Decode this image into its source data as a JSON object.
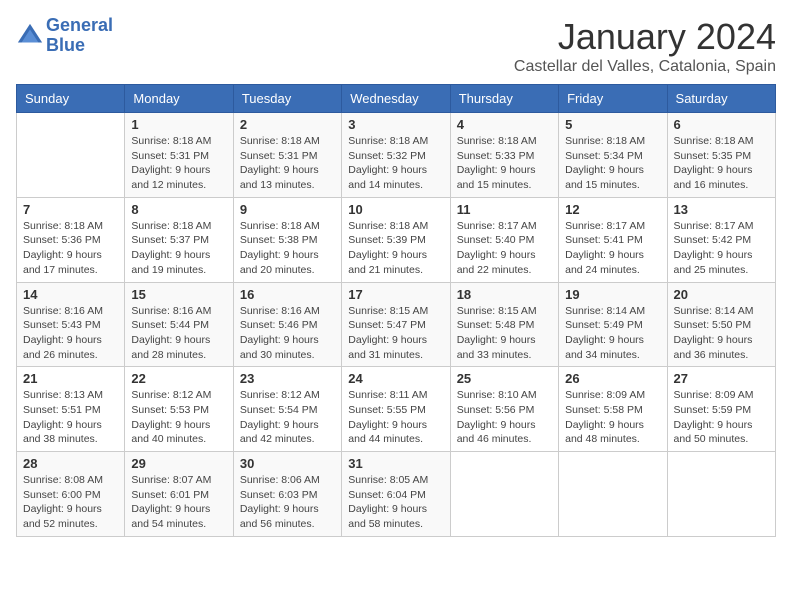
{
  "logo": {
    "line1": "General",
    "line2": "Blue"
  },
  "title": "January 2024",
  "location": "Castellar del Valles, Catalonia, Spain",
  "headers": [
    "Sunday",
    "Monday",
    "Tuesday",
    "Wednesday",
    "Thursday",
    "Friday",
    "Saturday"
  ],
  "weeks": [
    [
      {
        "day": "",
        "sunrise": "",
        "sunset": "",
        "daylight": ""
      },
      {
        "day": "1",
        "sunrise": "Sunrise: 8:18 AM",
        "sunset": "Sunset: 5:31 PM",
        "daylight": "Daylight: 9 hours and 12 minutes."
      },
      {
        "day": "2",
        "sunrise": "Sunrise: 8:18 AM",
        "sunset": "Sunset: 5:31 PM",
        "daylight": "Daylight: 9 hours and 13 minutes."
      },
      {
        "day": "3",
        "sunrise": "Sunrise: 8:18 AM",
        "sunset": "Sunset: 5:32 PM",
        "daylight": "Daylight: 9 hours and 14 minutes."
      },
      {
        "day": "4",
        "sunrise": "Sunrise: 8:18 AM",
        "sunset": "Sunset: 5:33 PM",
        "daylight": "Daylight: 9 hours and 15 minutes."
      },
      {
        "day": "5",
        "sunrise": "Sunrise: 8:18 AM",
        "sunset": "Sunset: 5:34 PM",
        "daylight": "Daylight: 9 hours and 15 minutes."
      },
      {
        "day": "6",
        "sunrise": "Sunrise: 8:18 AM",
        "sunset": "Sunset: 5:35 PM",
        "daylight": "Daylight: 9 hours and 16 minutes."
      }
    ],
    [
      {
        "day": "7",
        "sunrise": "Sunrise: 8:18 AM",
        "sunset": "Sunset: 5:36 PM",
        "daylight": "Daylight: 9 hours and 17 minutes."
      },
      {
        "day": "8",
        "sunrise": "Sunrise: 8:18 AM",
        "sunset": "Sunset: 5:37 PM",
        "daylight": "Daylight: 9 hours and 19 minutes."
      },
      {
        "day": "9",
        "sunrise": "Sunrise: 8:18 AM",
        "sunset": "Sunset: 5:38 PM",
        "daylight": "Daylight: 9 hours and 20 minutes."
      },
      {
        "day": "10",
        "sunrise": "Sunrise: 8:18 AM",
        "sunset": "Sunset: 5:39 PM",
        "daylight": "Daylight: 9 hours and 21 minutes."
      },
      {
        "day": "11",
        "sunrise": "Sunrise: 8:17 AM",
        "sunset": "Sunset: 5:40 PM",
        "daylight": "Daylight: 9 hours and 22 minutes."
      },
      {
        "day": "12",
        "sunrise": "Sunrise: 8:17 AM",
        "sunset": "Sunset: 5:41 PM",
        "daylight": "Daylight: 9 hours and 24 minutes."
      },
      {
        "day": "13",
        "sunrise": "Sunrise: 8:17 AM",
        "sunset": "Sunset: 5:42 PM",
        "daylight": "Daylight: 9 hours and 25 minutes."
      }
    ],
    [
      {
        "day": "14",
        "sunrise": "Sunrise: 8:16 AM",
        "sunset": "Sunset: 5:43 PM",
        "daylight": "Daylight: 9 hours and 26 minutes."
      },
      {
        "day": "15",
        "sunrise": "Sunrise: 8:16 AM",
        "sunset": "Sunset: 5:44 PM",
        "daylight": "Daylight: 9 hours and 28 minutes."
      },
      {
        "day": "16",
        "sunrise": "Sunrise: 8:16 AM",
        "sunset": "Sunset: 5:46 PM",
        "daylight": "Daylight: 9 hours and 30 minutes."
      },
      {
        "day": "17",
        "sunrise": "Sunrise: 8:15 AM",
        "sunset": "Sunset: 5:47 PM",
        "daylight": "Daylight: 9 hours and 31 minutes."
      },
      {
        "day": "18",
        "sunrise": "Sunrise: 8:15 AM",
        "sunset": "Sunset: 5:48 PM",
        "daylight": "Daylight: 9 hours and 33 minutes."
      },
      {
        "day": "19",
        "sunrise": "Sunrise: 8:14 AM",
        "sunset": "Sunset: 5:49 PM",
        "daylight": "Daylight: 9 hours and 34 minutes."
      },
      {
        "day": "20",
        "sunrise": "Sunrise: 8:14 AM",
        "sunset": "Sunset: 5:50 PM",
        "daylight": "Daylight: 9 hours and 36 minutes."
      }
    ],
    [
      {
        "day": "21",
        "sunrise": "Sunrise: 8:13 AM",
        "sunset": "Sunset: 5:51 PM",
        "daylight": "Daylight: 9 hours and 38 minutes."
      },
      {
        "day": "22",
        "sunrise": "Sunrise: 8:12 AM",
        "sunset": "Sunset: 5:53 PM",
        "daylight": "Daylight: 9 hours and 40 minutes."
      },
      {
        "day": "23",
        "sunrise": "Sunrise: 8:12 AM",
        "sunset": "Sunset: 5:54 PM",
        "daylight": "Daylight: 9 hours and 42 minutes."
      },
      {
        "day": "24",
        "sunrise": "Sunrise: 8:11 AM",
        "sunset": "Sunset: 5:55 PM",
        "daylight": "Daylight: 9 hours and 44 minutes."
      },
      {
        "day": "25",
        "sunrise": "Sunrise: 8:10 AM",
        "sunset": "Sunset: 5:56 PM",
        "daylight": "Daylight: 9 hours and 46 minutes."
      },
      {
        "day": "26",
        "sunrise": "Sunrise: 8:09 AM",
        "sunset": "Sunset: 5:58 PM",
        "daylight": "Daylight: 9 hours and 48 minutes."
      },
      {
        "day": "27",
        "sunrise": "Sunrise: 8:09 AM",
        "sunset": "Sunset: 5:59 PM",
        "daylight": "Daylight: 9 hours and 50 minutes."
      }
    ],
    [
      {
        "day": "28",
        "sunrise": "Sunrise: 8:08 AM",
        "sunset": "Sunset: 6:00 PM",
        "daylight": "Daylight: 9 hours and 52 minutes."
      },
      {
        "day": "29",
        "sunrise": "Sunrise: 8:07 AM",
        "sunset": "Sunset: 6:01 PM",
        "daylight": "Daylight: 9 hours and 54 minutes."
      },
      {
        "day": "30",
        "sunrise": "Sunrise: 8:06 AM",
        "sunset": "Sunset: 6:03 PM",
        "daylight": "Daylight: 9 hours and 56 minutes."
      },
      {
        "day": "31",
        "sunrise": "Sunrise: 8:05 AM",
        "sunset": "Sunset: 6:04 PM",
        "daylight": "Daylight: 9 hours and 58 minutes."
      },
      {
        "day": "",
        "sunrise": "",
        "sunset": "",
        "daylight": ""
      },
      {
        "day": "",
        "sunrise": "",
        "sunset": "",
        "daylight": ""
      },
      {
        "day": "",
        "sunrise": "",
        "sunset": "",
        "daylight": ""
      }
    ]
  ]
}
